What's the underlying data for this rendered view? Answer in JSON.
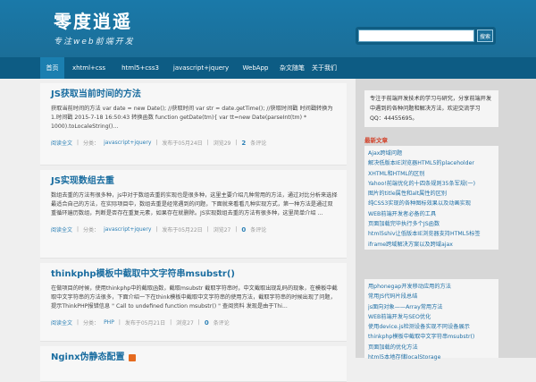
{
  "header": {
    "logo_title": "零度逍遥",
    "logo_subtitle": "专注web前端开发",
    "search_placeholder": "",
    "search_button": "搜索"
  },
  "nav": {
    "items": [
      {
        "label": "首页"
      },
      {
        "label": "xhtml+css"
      },
      {
        "label": "html5+css3"
      },
      {
        "label": "javascript+jquery"
      },
      {
        "label": "WebApp"
      },
      {
        "label": "杂文随笔"
      },
      {
        "label": "关于我们"
      }
    ],
    "active_index": 0
  },
  "posts": [
    {
      "title": "JS获取当前时间的方法",
      "excerpt": "获取当前时间的方法 var date = new Date(); //获取时间 var str = date.getTime(); //获取时间戳 时间戳转换为 1.时间戳 2015-7-18 16:50:43 转换函数 function getDate(tm){ var tt=new Date(parseInt(tm) * 1000).toLocaleString()...",
      "category_label": "分类：",
      "category": "javascript+jquery",
      "date": "发布于05月24日",
      "views": "浏览29",
      "comments": "2",
      "comments_label": "条评论",
      "read_more": "阅读全文"
    },
    {
      "title": "JS实现数组去重",
      "excerpt": "数组去重的方法有很多种，js中对于数组去重的实现也是很多种，这里主要介绍几种常用的方法，通过对比分析来选择最适合自己的方法，在实际项目中，数组去重是经常遇到的问题，下面就来看看几种实现方式，第一种方法是通过双重循环遍历数组，判断是否存在重复元素，如果存在就删除。JS实现数组去重的方法有很多种，这里简单介绍 ...",
      "category_label": "分类：",
      "category": "javascript+jquery",
      "date": "发布于05月22日",
      "views": "浏览27",
      "comments": "0",
      "comments_label": "条评论",
      "read_more": "阅读全文"
    },
    {
      "title": "thinkphp模板中截取中文字符串msubstr()",
      "excerpt": "在做项目的时候，使用thinkphp中的截取函数，截取msubstr 截取字符串时，中文截取出现乱码的现象，在模板中截取中文字符串的方法很多，下面介绍一下在think模板中截取中文字符串的使用方法，截取字符串的时候出现了问题，提示ThinkPHP报错信息 \" Call to undefined function msubstr() \" 查阅资料 发现是由于Thi...",
      "category_label": "分类：",
      "category": "PHP",
      "date": "发布于05月21日",
      "views": "浏览27",
      "comments": "0",
      "comments_label": "条评论",
      "read_more": "阅读全文"
    },
    {
      "title": "Nginx伪静态配置"
    }
  ],
  "sidebar": {
    "about_text": "专注于前端开发技术的学习与研究，分享前端开发中遇到的各种问题和解决方法，欢迎交流学习QQ：44455695。",
    "recent_title": "最新文章",
    "recent_links": [
      "Ajax跨域问题",
      "解决低版本IE浏览器HTML5的placeholder",
      "XHTML和HTML的区别",
      "Yahoo!前端优化的十四条规则35条军规(一)",
      "图片的title属性和alt属性的区别",
      "纯CSS3实现的各种图标效果以及动画实现",
      "WEB前端开发者必备的工具",
      "页面加载完毕执行多个JS函数",
      "html5shiv让低版本IE浏览器支持HTML5标签",
      "iframe跨域解决方案以及跨域ajax"
    ],
    "related_links": [
      "用phonegap开发移动应用的方法",
      "常用JS代码片段总结",
      "js面向对象——Array常用方法",
      "WEB前端开发与SEO优化",
      "使用device.js检测设备实现不同设备展示",
      "thinkphp模板中截取中文字符串msubstr()",
      "页面加载的优化方法",
      "html5本地存储localStorage"
    ]
  }
}
